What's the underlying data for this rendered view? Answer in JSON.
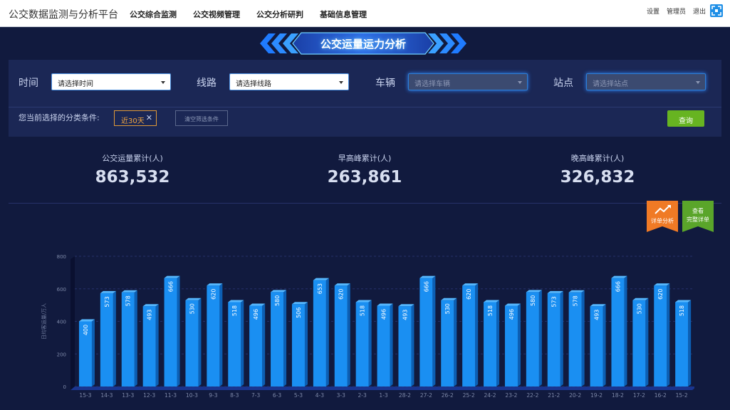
{
  "app": {
    "title": "公交数据监测与分析平台",
    "nav": [
      "公交综合监测",
      "公交视频管理",
      "公交分析研判",
      "基础信息管理"
    ],
    "links": {
      "settings": "设置",
      "user": "管理员",
      "logout": "退出"
    }
  },
  "page": {
    "title": "公交运量运力分析"
  },
  "filters": {
    "time": {
      "label": "时间",
      "placeholder": "请选择时间"
    },
    "route": {
      "label": "线路",
      "placeholder": "请选择线路"
    },
    "vehicle": {
      "label": "车辆",
      "placeholder": "请选择车辆"
    },
    "stop": {
      "label": "站点",
      "placeholder": "请选择站点"
    },
    "condition_label": "您当前选择的分类条件:",
    "active_tag": "近30天",
    "clear_label": "清空筛选条件",
    "query_label": "查询"
  },
  "stats": [
    {
      "label": "公交运量累计(人)",
      "value": "863,532"
    },
    {
      "label": "早高峰累计(人)",
      "value": "263,861"
    },
    {
      "label": "晚高峰累计(人)",
      "value": "326,832"
    }
  ],
  "badges": {
    "detail": {
      "line1": "详单分析"
    },
    "full": {
      "line1": "查看",
      "line2": "完整详单"
    }
  },
  "colors": {
    "bar": "#1a8ff2",
    "orange": "#f07a25",
    "green": "#5aa52a",
    "background": "#111a3e"
  },
  "chart_data": {
    "type": "bar",
    "ylabel": "日均客运量/万人",
    "ylim": [
      0,
      800
    ],
    "yticks": [
      0,
      200,
      400,
      600,
      800
    ],
    "categories": [
      "15-3",
      "14-3",
      "13-3",
      "12-3",
      "11-3",
      "10-3",
      "9-3",
      "8-3",
      "7-3",
      "6-3",
      "5-3",
      "4-3",
      "3-3",
      "2-3",
      "1-3",
      "28-2",
      "27-2",
      "26-2",
      "25-2",
      "24-2",
      "23-2",
      "22-2",
      "21-2",
      "20-2",
      "19-2",
      "18-2",
      "17-2",
      "16-2",
      "15-2"
    ],
    "values": [
      400,
      573,
      578,
      493,
      666,
      530,
      620,
      518,
      496,
      580,
      506,
      653,
      620,
      518,
      496,
      493,
      666,
      530,
      620,
      518,
      496,
      580,
      573,
      578,
      493,
      666,
      530,
      620,
      518
    ]
  }
}
